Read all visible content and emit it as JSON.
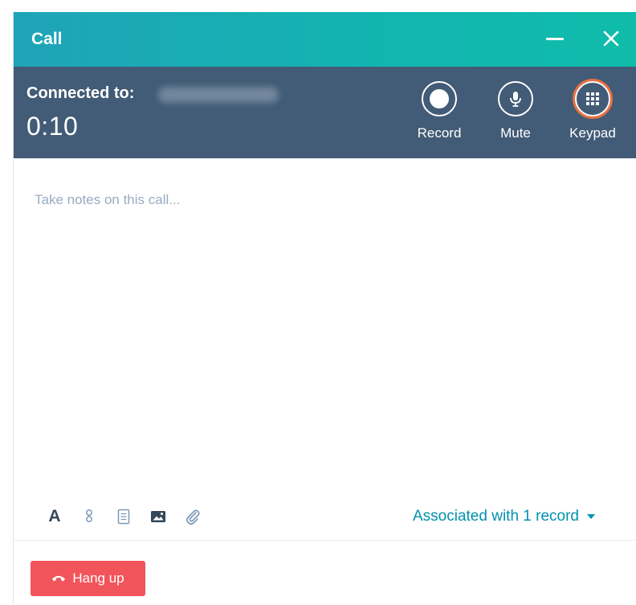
{
  "window": {
    "title": "Call",
    "minimize_icon": "minimize-icon",
    "close_icon": "close-icon"
  },
  "call": {
    "connected_label": "Connected to:",
    "timer": "0:10",
    "controls": [
      {
        "label": "Record",
        "icon": "record-icon"
      },
      {
        "label": "Mute",
        "icon": "microphone-icon"
      },
      {
        "label": "Keypad",
        "icon": "keypad-icon"
      }
    ]
  },
  "notes": {
    "placeholder": "Take notes on this call..."
  },
  "toolbar": {
    "items": [
      {
        "name": "text-format",
        "glyph": "A"
      },
      {
        "name": "personalization",
        "icon": "token-icon"
      },
      {
        "name": "snippet",
        "icon": "document-icon"
      },
      {
        "name": "image",
        "icon": "image-icon"
      },
      {
        "name": "attachment",
        "icon": "paperclip-icon"
      }
    ]
  },
  "association": {
    "label": "Associated with 1 record"
  },
  "footer": {
    "hang_up_label": "Hang up"
  },
  "colors": {
    "header_teal": "#12b5b0",
    "callbar": "#425b76",
    "accent_link": "#0091ae",
    "keypad_highlight": "#ea6e40",
    "hang_up": "#f2545b"
  }
}
